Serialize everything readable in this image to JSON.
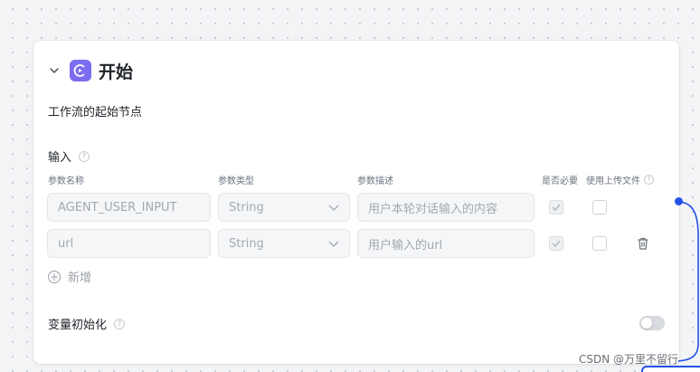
{
  "node": {
    "title": "开始",
    "description": "工作流的起始节点"
  },
  "input_section": {
    "label": "输入",
    "help": "?",
    "columns": {
      "name": "参数名称",
      "type": "参数类型",
      "desc": "参数描述",
      "required": "是否必要",
      "upload": "使用上传文件"
    },
    "rows": [
      {
        "name": "AGENT_USER_INPUT",
        "type": "String",
        "desc": "用户本轮对话输入的内容",
        "required": true,
        "upload": false
      },
      {
        "name": "url",
        "type": "String",
        "desc": "用户输入的url",
        "required": true,
        "upload": false
      }
    ],
    "add_label": "新增"
  },
  "variable_init": {
    "label": "变量初始化",
    "help": "?",
    "enabled": false
  },
  "watermark": "CSDN @万里不留行",
  "colors": {
    "accent": "#2451e6",
    "node_icon": "#7c6cf0"
  },
  "icons": [
    "chevron-down-icon",
    "start-node-icon",
    "help-icon",
    "chevron-down-icon",
    "checkbox-icon",
    "trash-icon",
    "plus-circle-icon"
  ]
}
